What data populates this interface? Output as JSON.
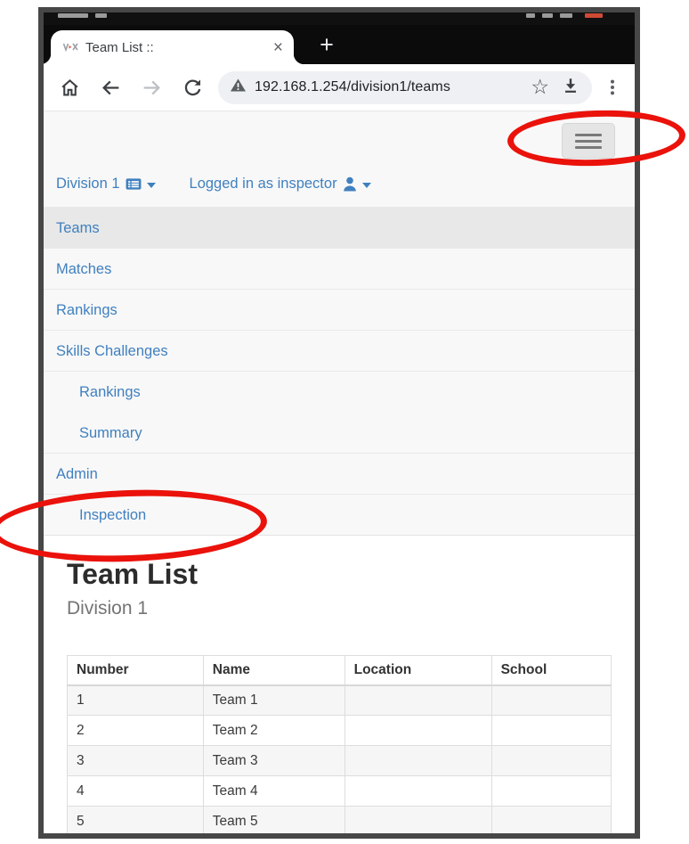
{
  "browser": {
    "tab_title": "Team List ::",
    "close_glyph": "×",
    "new_tab_glyph": "+",
    "url": "192.168.1.254/division1/teams",
    "bookmark_glyph": "☆"
  },
  "navbar": {
    "division_label": "Division 1",
    "user_label": "Logged in as inspector",
    "items": [
      {
        "label": "Teams",
        "active": true,
        "indent": false
      },
      {
        "label": "Matches",
        "active": false,
        "indent": false
      },
      {
        "label": "Rankings",
        "active": false,
        "indent": false
      },
      {
        "label": "Skills Challenges",
        "active": false,
        "indent": false
      },
      {
        "label": "Rankings",
        "active": false,
        "indent": true
      },
      {
        "label": "Summary",
        "active": false,
        "indent": true
      },
      {
        "label": "Admin",
        "active": false,
        "indent": false
      },
      {
        "label": "Inspection",
        "active": false,
        "indent": true
      }
    ]
  },
  "page": {
    "title": "Team List",
    "subtitle": "Division 1"
  },
  "table": {
    "headers": [
      "Number",
      "Name",
      "Location",
      "School"
    ],
    "rows": [
      [
        "1",
        "Team 1",
        "",
        ""
      ],
      [
        "2",
        "Team 2",
        "",
        ""
      ],
      [
        "3",
        "Team 3",
        "",
        ""
      ],
      [
        "4",
        "Team 4",
        "",
        ""
      ],
      [
        "5",
        "Team 5",
        "",
        ""
      ]
    ]
  },
  "colors": {
    "link_blue": "#4080bf",
    "annotation_red": "#ea120b",
    "active_row_bg": "#e8e8e8",
    "frame_grey": "#474747"
  }
}
